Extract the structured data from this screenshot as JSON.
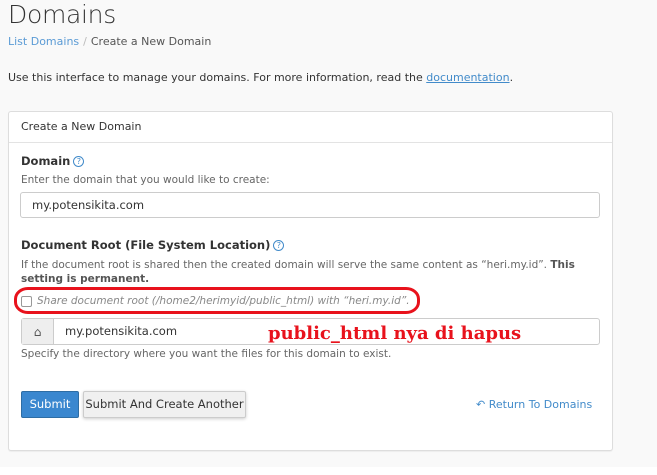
{
  "page": {
    "title": "Domains",
    "breadcrumb": {
      "parent": "List Domains",
      "separator": "/",
      "current": "Create a New Domain"
    },
    "intro": {
      "text": "Use this interface to manage your domains. For more information, read the ",
      "link": "documentation",
      "end": "."
    }
  },
  "panel": {
    "title": "Create a New Domain",
    "domain": {
      "label": "Domain",
      "help_icon": "?",
      "hint": "Enter the domain that you would like to create:",
      "value": "my.potensikita.com"
    },
    "docroot": {
      "label": "Document Root (File System Location)",
      "help_icon": "?",
      "hint": "If the document root is shared then the created domain will serve the same content as “heri.my.id”. ",
      "hint_bold": "This setting is permanent.",
      "share_label": "Share document root (/home2/herimyid/public_html) with “heri.my.id”.",
      "share_checked": false,
      "home_icon": "home-icon",
      "value": "my.potensikita.com",
      "specify": "Specify the directory where you want the files for this domain to exist."
    },
    "buttons": {
      "submit": "Submit",
      "another": "Submit And Create Another",
      "return": "Return To Domains",
      "return_icon": "reply-icon"
    }
  },
  "annotation": {
    "text": "public_html nya di hapus",
    "color": "#e8121c"
  }
}
